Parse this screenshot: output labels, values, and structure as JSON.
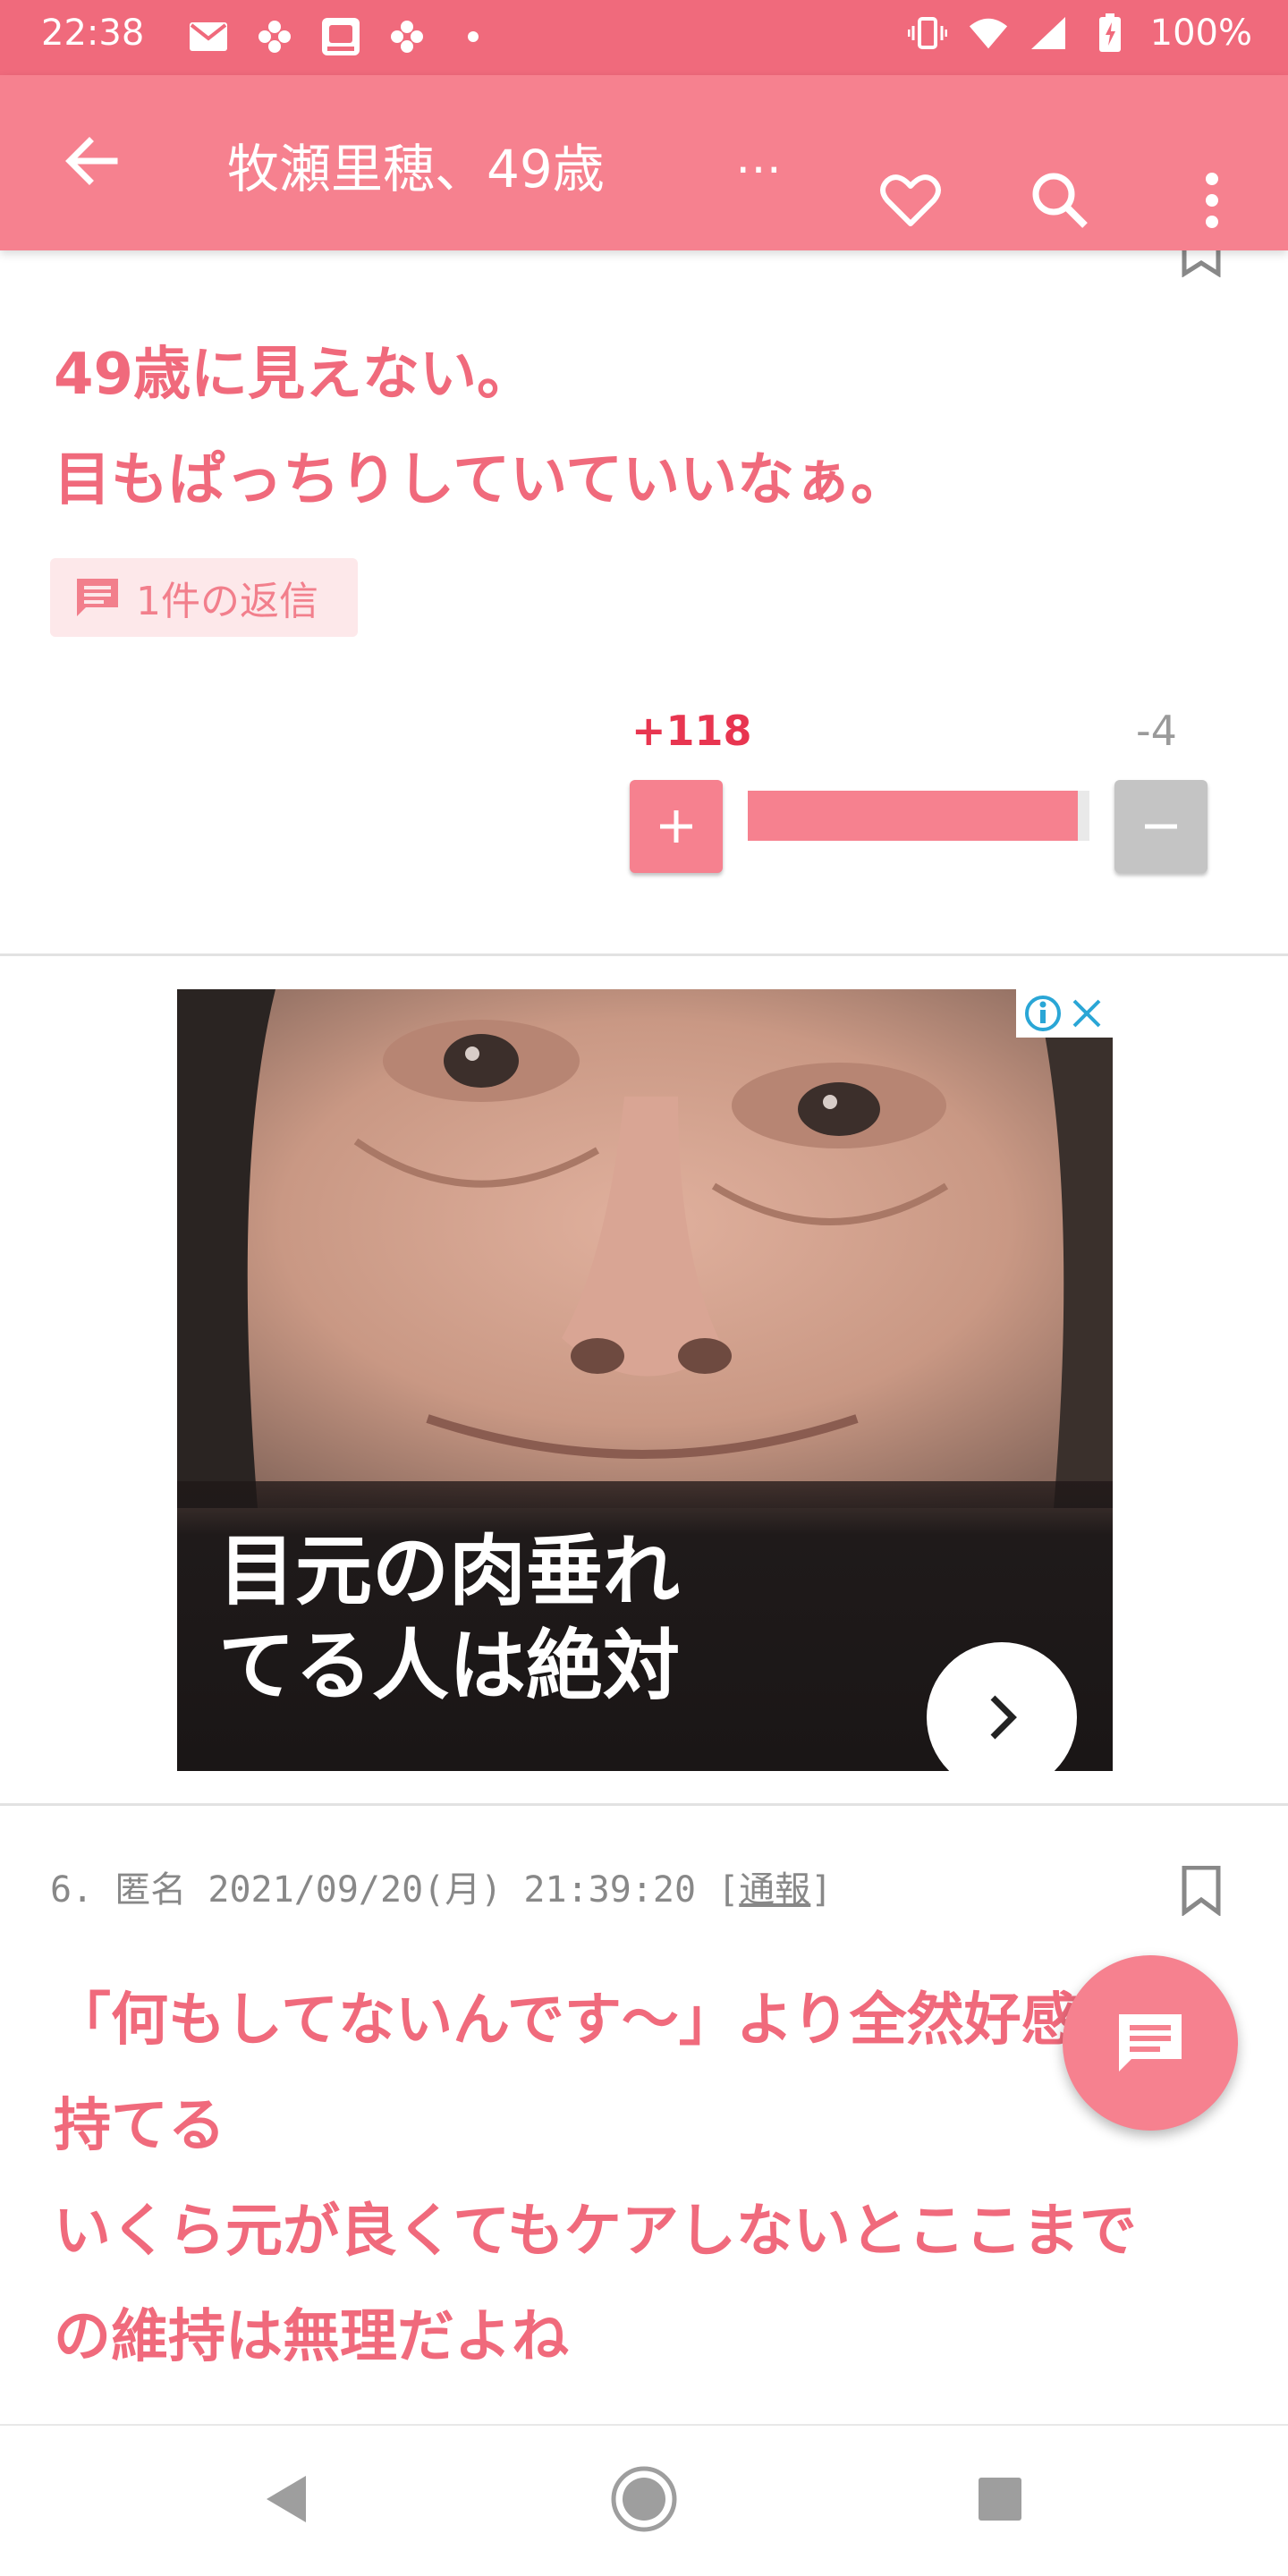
{
  "colors": {
    "accent": "#f6818f",
    "status_bar": "#f06a7c",
    "comment_text": "#f06a7c",
    "plus": "#e83550",
    "minus": "#9a9a9a"
  },
  "status_bar": {
    "time": "22:38",
    "battery": "100%",
    "notification_icons": [
      "mail-icon",
      "pinwheel-icon",
      "store-app-icon",
      "pinwheel-icon",
      "dot-icon"
    ],
    "right_icons": [
      "vibrate-icon",
      "wifi-icon",
      "signal-icon",
      "battery-icon"
    ]
  },
  "app_bar": {
    "title": "牧瀬里穂、49歳",
    "title_ellipsis": "…",
    "icons": [
      "back-arrow-icon",
      "heart-icon",
      "search-icon",
      "more-vert-icon"
    ]
  },
  "comment5": {
    "lines": [
      "49歳に見えない。",
      "目もぱっちりしていていいなぁ。"
    ],
    "reply_label": "1件の返信",
    "plus_count": "+118",
    "minus_count": "-4",
    "plus_fraction": 0.967
  },
  "ad": {
    "line1": "目元の肉垂れ",
    "line2": "てる人は絶対"
  },
  "comment6": {
    "number": "6.",
    "author": "匿名",
    "date": "2021/09/20(月) 21:39:20",
    "report_open": "[",
    "report": "通報",
    "report_close": "]",
    "lines": [
      "「何もしてないんです〜」より全然好感が",
      "持てる",
      "いくら元が良くてもケアしないとここまで",
      "の維持は無理だよね"
    ]
  }
}
